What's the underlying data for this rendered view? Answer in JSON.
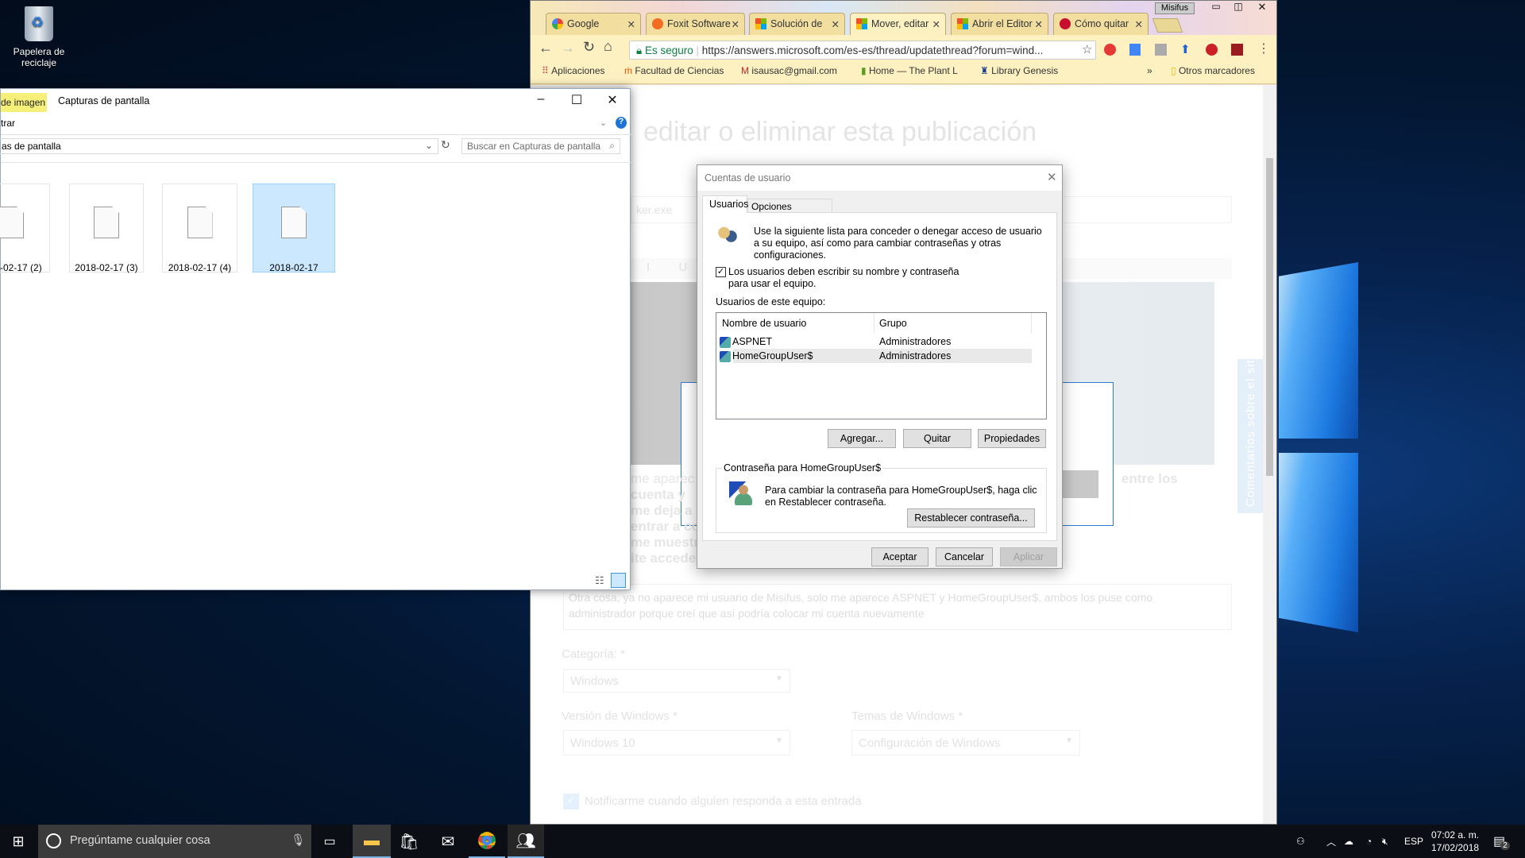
{
  "desktop": {
    "recycle_bin_label": "Papelera de reciclaje"
  },
  "explorer": {
    "ribbon_tab": "de imagen",
    "title": "Capturas de pantalla",
    "ribbon_item": "trar",
    "address": "as de pantalla",
    "search_placeholder": "Buscar en Capturas de pantalla",
    "files": [
      {
        "name": "-02-17 (2)",
        "selected": false
      },
      {
        "name": "2018-02-17 (3)",
        "selected": false
      },
      {
        "name": "2018-02-17 (4)",
        "selected": false
      },
      {
        "name": "2018-02-17",
        "selected": true
      }
    ]
  },
  "chrome": {
    "profile": "Misifus",
    "tabs": [
      {
        "title": "Google",
        "icon": "google-icon"
      },
      {
        "title": "Foxit Software",
        "icon": "foxit-icon"
      },
      {
        "title": "Solución de",
        "icon": "microsoft-icon"
      },
      {
        "title": "Mover, editar",
        "icon": "microsoft-icon",
        "active": true
      },
      {
        "title": "Abrir el Editor",
        "icon": "microsoft-icon"
      },
      {
        "title": "Cómo quitar",
        "icon": "question-icon"
      }
    ],
    "secure_label": "Es seguro",
    "url": "https://answers.microsoft.com/es-es/thread/updatethread?forum=wind...",
    "bookmarks": [
      "Aplicaciones",
      "Facultad de Ciencias",
      "isausac@gmail.com",
      "Home — The Plant L",
      "Library Genesis"
    ],
    "bookmarks_overflow": "»",
    "other_bookmarks": "Otros marcadores"
  },
  "page": {
    "heading": "editar o eliminar esta publicación",
    "title_input": "ker.exe",
    "body_fragments": [
      "me aparec",
      "cuenta y",
      "me deja a",
      "entrar a co",
      "me muestra",
      "ite acceder"
    ],
    "body_fragment_right": "entre los",
    "textarea_line1": "Otra cosa, ya no aparece mi usuario de Misifus, solo me aparece ASPNET y HomeGroupUser$, ambos los puse como",
    "textarea_line2": "administrador porque creí que así podría colocar mi cuenta nuevamente",
    "category_label": "Categoría: *",
    "category_value": "Windows",
    "version_label": "Versión de Windows *",
    "version_value": "Windows 10",
    "topics_label": "Temas de Windows *",
    "topics_value": "Configuración de Windows",
    "notify_label": "Notificarme cuando alguien responda a esta entrada",
    "feedback_tab": "Comentarios sobre el sitio"
  },
  "dialog": {
    "title": "Cuentas de usuario",
    "tabs": [
      "Usuarios",
      "Opciones avanzadas"
    ],
    "intro": "Use la siguiente lista para conceder o denegar acceso de usuario a su equipo, así como para cambiar contraseñas y otras configuraciones.",
    "require_login_label": "Los usuarios deben escribir su nombre y contraseña para usar el equipo.",
    "require_login_checked": true,
    "users_label": "Usuarios de este equipo:",
    "columns": [
      "Nombre de usuario",
      "Grupo"
    ],
    "users": [
      {
        "name": "ASPNET",
        "group": "Administradores"
      },
      {
        "name": "HomeGroupUser$",
        "group": "Administradores",
        "selected": true
      }
    ],
    "add_button": "Agregar...",
    "remove_button": "Quitar",
    "properties_button": "Propiedades",
    "password_group": "Contraseña para HomeGroupUser$",
    "password_text": "Para cambiar la contraseña para HomeGroupUser$, haga clic en Restablecer contraseña.",
    "reset_button": "Restablecer contraseña...",
    "ok_button": "Aceptar",
    "cancel_button": "Cancelar",
    "apply_button": "Aplicar"
  },
  "taskbar": {
    "search_placeholder": "Pregúntame cualquier cosa",
    "language": "ESP",
    "time": "07:02 a. m.",
    "date": "17/02/2018",
    "notifications": "2"
  }
}
